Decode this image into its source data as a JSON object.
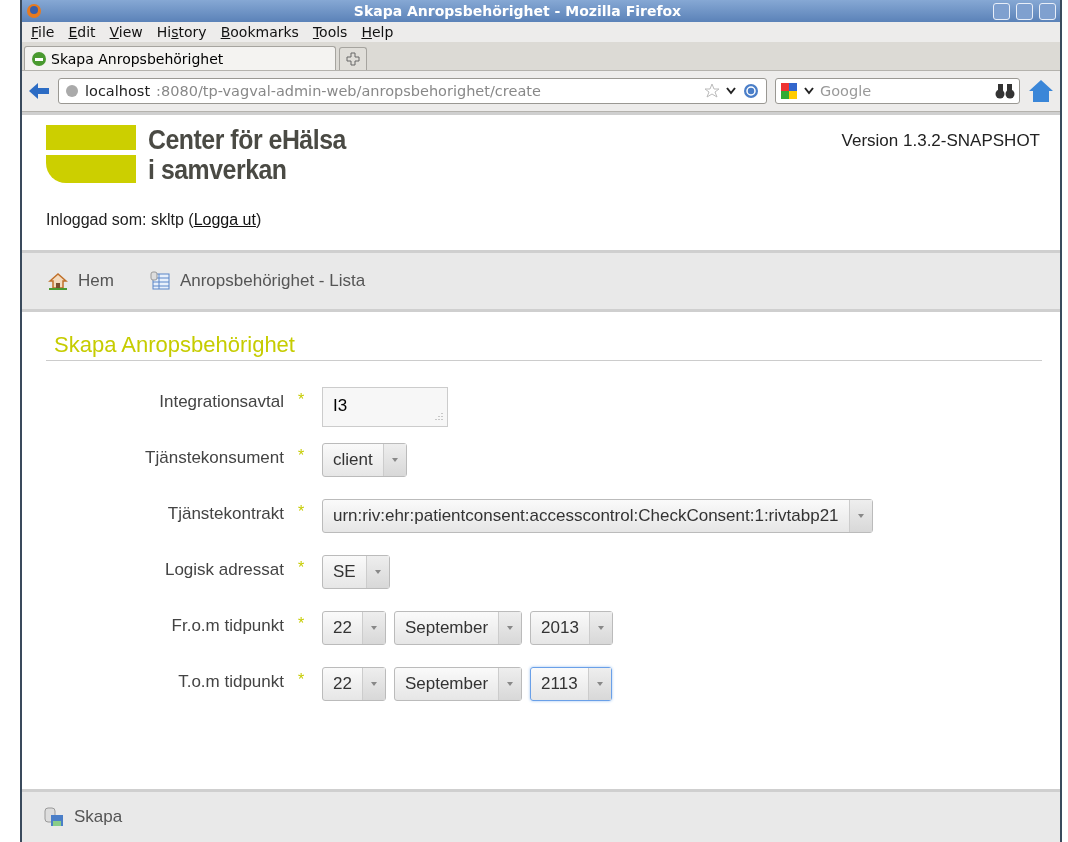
{
  "window": {
    "title": "Skapa Anropsbehörighet - Mozilla Firefox"
  },
  "menu": [
    {
      "key": "F",
      "after": "ile"
    },
    {
      "key": "E",
      "after": "dit"
    },
    {
      "key": "V",
      "after": "iew"
    },
    {
      "before": "Hi",
      "key": "s",
      "after": "tory"
    },
    {
      "key": "B",
      "after": "ookmarks"
    },
    {
      "key": "T",
      "after": "ools"
    },
    {
      "key": "H",
      "after": "elp"
    }
  ],
  "tabs": [
    {
      "label": "Skapa Anropsbehörighet",
      "selected": true
    }
  ],
  "address": {
    "host": "localhost",
    "rest": ":8080/tp-vagval-admin-web/anropsbehorighet/create"
  },
  "search": {
    "placeholder": "Google"
  },
  "page": {
    "logo_line_1": "Center för eHälsa",
    "logo_line_2": "i samverkan",
    "version": "Version 1.3.2-SNAPSHOT",
    "login_prefix": "Inloggad som: skltp (",
    "logout_link": "Logga ut",
    "login_suffix": ")",
    "nav": [
      {
        "kind": "home",
        "label": "Hem"
      },
      {
        "kind": "list",
        "label": "Anropsbehörighet - Lista"
      }
    ],
    "heading": "Skapa Anropsbehörighet",
    "fields": [
      {
        "label": "Integrationsavtal",
        "required": "*",
        "kind": "textarea",
        "value": "I3"
      },
      {
        "label": "Tjänstekonsument",
        "required": "*",
        "kind": "select",
        "selects": [
          {
            "value": "client",
            "focused": false
          }
        ]
      },
      {
        "label": "Tjänstekontrakt",
        "required": "*",
        "kind": "select",
        "selects": [
          {
            "value": "urn:riv:ehr:patientconsent:accesscontrol:CheckConsent:1:rivtabp21",
            "focused": false
          }
        ]
      },
      {
        "label": "Logisk adressat",
        "required": "*",
        "kind": "select",
        "selects": [
          {
            "value": "SE",
            "focused": false
          }
        ]
      },
      {
        "label": "Fr.o.m tidpunkt",
        "required": "*",
        "kind": "select",
        "selects": [
          {
            "value": "22",
            "focused": false
          },
          {
            "value": "September",
            "focused": false
          },
          {
            "value": "2013",
            "focused": false
          }
        ]
      },
      {
        "label": "T.o.m tidpunkt",
        "required": "*",
        "kind": "select",
        "selects": [
          {
            "value": "22",
            "focused": false
          },
          {
            "value": "September",
            "focused": false
          },
          {
            "value": "2113",
            "focused": true
          }
        ]
      }
    ],
    "action": {
      "label": "Skapa"
    }
  }
}
